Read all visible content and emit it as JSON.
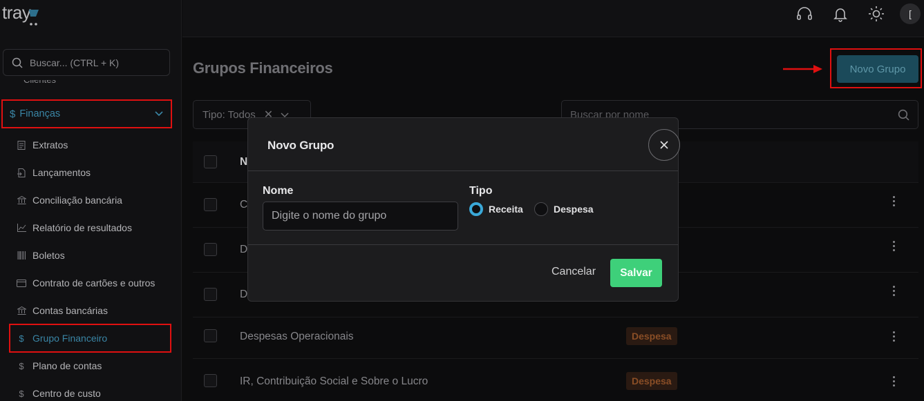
{
  "app": {
    "logo": "tray"
  },
  "sidebar": {
    "search_placeholder": "Buscar... (CTRL + K)",
    "clipped_item": "Clientes",
    "finance": {
      "label": "Finanças",
      "icon": "dollar-icon"
    },
    "items": [
      {
        "label": "Extratos",
        "icon": "document-icon"
      },
      {
        "label": "Lançamentos",
        "icon": "file-transfer-icon"
      },
      {
        "label": "Conciliação bancária",
        "icon": "bank-icon"
      },
      {
        "label": "Relatório de resultados",
        "icon": "chart-icon"
      },
      {
        "label": "Boletos",
        "icon": "barcode-icon"
      },
      {
        "label": "Contrato de cartões e outros",
        "icon": "credit-card-icon"
      },
      {
        "label": "Contas bancárias",
        "icon": "bank-icon"
      },
      {
        "label": "Grupo Financeiro",
        "icon": "dollar-icon",
        "active": true
      },
      {
        "label": "Plano de contas",
        "icon": "dollar-icon"
      },
      {
        "label": "Centro de custo",
        "icon": "dollar-icon"
      }
    ]
  },
  "topbar": {
    "icons": [
      "headset-icon",
      "bell-icon",
      "sun-icon"
    ],
    "avatar_text": "["
  },
  "main": {
    "title": "Grupos Financeiros",
    "new_group_label": "Novo Grupo",
    "filter_label": "Tipo: Todos",
    "search_placeholder": "Buscar por nome",
    "table": {
      "header_first_char": "N",
      "rows": [
        {
          "name": "C",
          "badge": ""
        },
        {
          "name": "D",
          "badge": ""
        },
        {
          "name": "D",
          "badge": ""
        },
        {
          "name": "Despesas Operacionais",
          "badge": "Despesa"
        },
        {
          "name": "IR, Contribuição Social e Sobre o Lucro",
          "badge": "Despesa"
        }
      ]
    }
  },
  "modal": {
    "title": "Novo Grupo",
    "name_label": "Nome",
    "name_placeholder": "Digite o nome do grupo",
    "type_label": "Tipo",
    "option_income": "Receita",
    "option_expense": "Despesa",
    "selected": "Receita",
    "cancel_label": "Cancelar",
    "save_label": "Salvar"
  },
  "colors": {
    "highlight_border": "#e01010",
    "accent_blue": "#3a86a6",
    "save_green": "#3ed07a",
    "radio_selected": "#3aa8d8",
    "badge_text": "#8a4e26"
  }
}
